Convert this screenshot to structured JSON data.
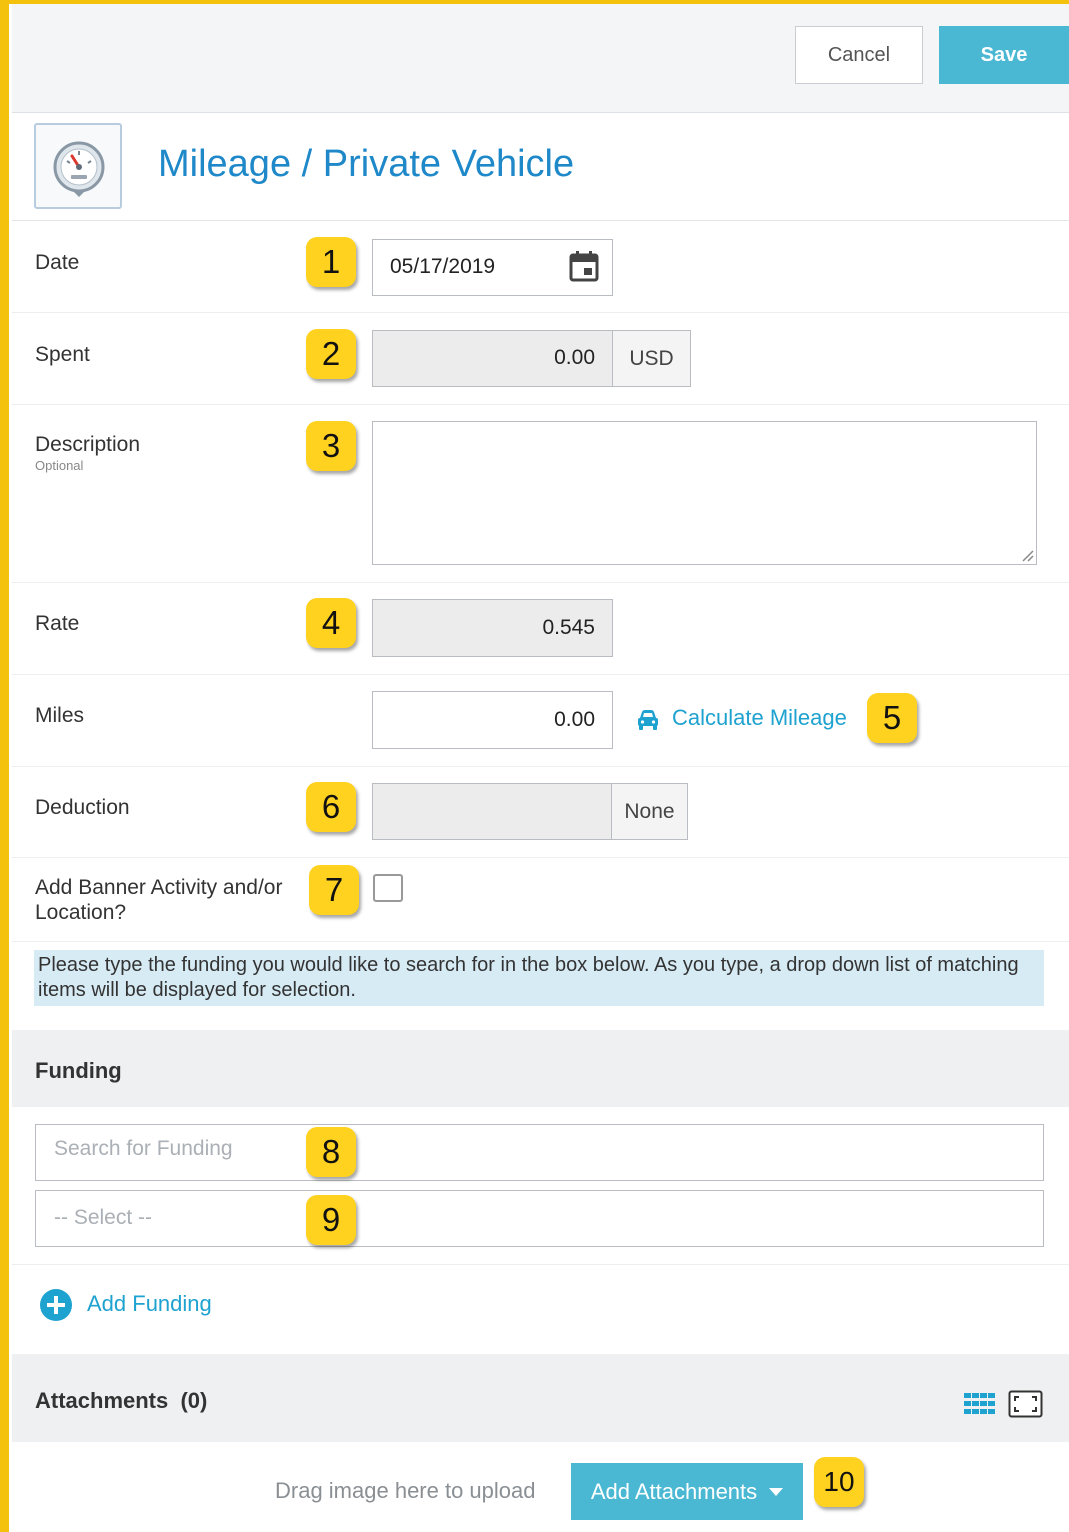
{
  "toolbar": {
    "cancel_label": "Cancel",
    "save_label": "Save"
  },
  "header": {
    "title": "Mileage / Private Vehicle",
    "icon": "speedometer-icon"
  },
  "fields": {
    "date": {
      "label": "Date",
      "value": "05/17/2019",
      "badge": "1"
    },
    "spent": {
      "label": "Spent",
      "value": "0.00",
      "currency": "USD",
      "badge": "2"
    },
    "description": {
      "label": "Description",
      "sublabel": "Optional",
      "value": "",
      "badge": "3"
    },
    "rate": {
      "label": "Rate",
      "value": "0.545",
      "badge": "4"
    },
    "miles": {
      "label": "Miles",
      "value": "0.00",
      "link_label": "Calculate Mileage",
      "badge": "5"
    },
    "deduction": {
      "label": "Deduction",
      "value": "",
      "addon": "None",
      "badge": "6"
    },
    "banner": {
      "label_line1": "Add Banner Activity and/or",
      "label_line2": "Location?",
      "checked": false,
      "badge": "7"
    }
  },
  "info_text": "Please type the funding you would like to search for in the box below. As you type, a drop down list of matching items will be displayed for selection.",
  "funding": {
    "title": "Funding",
    "search_placeholder": "Search for Funding",
    "select_placeholder": "-- Select --",
    "search_badge": "8",
    "select_badge": "9",
    "add_label": "Add Funding"
  },
  "attachments": {
    "title": "Attachments",
    "count": "(0)",
    "drag_text": "Drag image here to upload",
    "add_label": "Add Attachments",
    "badge": "10"
  },
  "colors": {
    "accent": "#4bb8d3",
    "link": "#1ea2cf",
    "title": "#1e88c8",
    "badge": "#ffd21f",
    "frame": "#f4c20d"
  }
}
